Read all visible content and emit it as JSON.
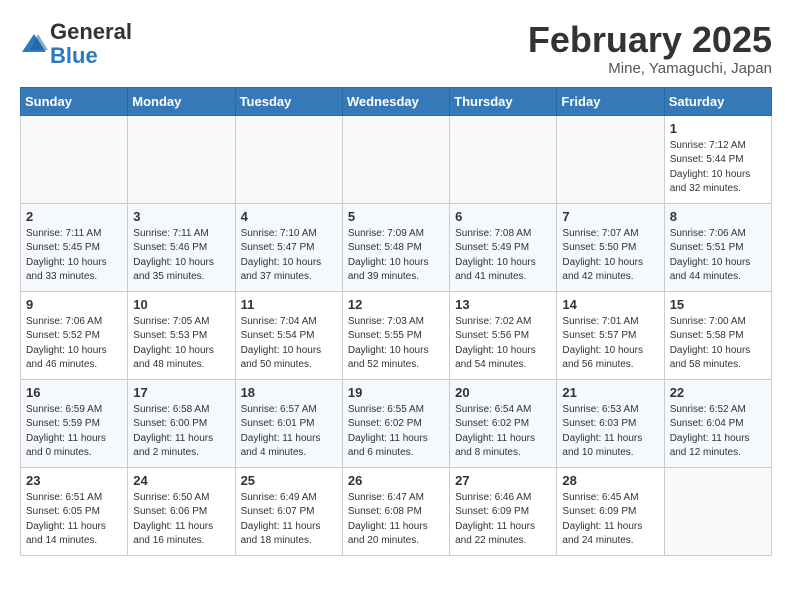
{
  "header": {
    "logo_general": "General",
    "logo_blue": "Blue",
    "month_title": "February 2025",
    "location": "Mine, Yamaguchi, Japan"
  },
  "days_of_week": [
    "Sunday",
    "Monday",
    "Tuesday",
    "Wednesday",
    "Thursday",
    "Friday",
    "Saturday"
  ],
  "weeks": [
    [
      {
        "day": null
      },
      {
        "day": null
      },
      {
        "day": null
      },
      {
        "day": null
      },
      {
        "day": null
      },
      {
        "day": null
      },
      {
        "day": 1,
        "sunrise": "7:12 AM",
        "sunset": "5:44 PM",
        "daylight": "Daylight: 10 hours and 32 minutes."
      }
    ],
    [
      {
        "day": 2,
        "sunrise": "7:11 AM",
        "sunset": "5:45 PM",
        "daylight": "Daylight: 10 hours and 33 minutes."
      },
      {
        "day": 3,
        "sunrise": "7:11 AM",
        "sunset": "5:46 PM",
        "daylight": "Daylight: 10 hours and 35 minutes."
      },
      {
        "day": 4,
        "sunrise": "7:10 AM",
        "sunset": "5:47 PM",
        "daylight": "Daylight: 10 hours and 37 minutes."
      },
      {
        "day": 5,
        "sunrise": "7:09 AM",
        "sunset": "5:48 PM",
        "daylight": "Daylight: 10 hours and 39 minutes."
      },
      {
        "day": 6,
        "sunrise": "7:08 AM",
        "sunset": "5:49 PM",
        "daylight": "Daylight: 10 hours and 41 minutes."
      },
      {
        "day": 7,
        "sunrise": "7:07 AM",
        "sunset": "5:50 PM",
        "daylight": "Daylight: 10 hours and 42 minutes."
      },
      {
        "day": 8,
        "sunrise": "7:06 AM",
        "sunset": "5:51 PM",
        "daylight": "Daylight: 10 hours and 44 minutes."
      }
    ],
    [
      {
        "day": 9,
        "sunrise": "7:06 AM",
        "sunset": "5:52 PM",
        "daylight": "Daylight: 10 hours and 46 minutes."
      },
      {
        "day": 10,
        "sunrise": "7:05 AM",
        "sunset": "5:53 PM",
        "daylight": "Daylight: 10 hours and 48 minutes."
      },
      {
        "day": 11,
        "sunrise": "7:04 AM",
        "sunset": "5:54 PM",
        "daylight": "Daylight: 10 hours and 50 minutes."
      },
      {
        "day": 12,
        "sunrise": "7:03 AM",
        "sunset": "5:55 PM",
        "daylight": "Daylight: 10 hours and 52 minutes."
      },
      {
        "day": 13,
        "sunrise": "7:02 AM",
        "sunset": "5:56 PM",
        "daylight": "Daylight: 10 hours and 54 minutes."
      },
      {
        "day": 14,
        "sunrise": "7:01 AM",
        "sunset": "5:57 PM",
        "daylight": "Daylight: 10 hours and 56 minutes."
      },
      {
        "day": 15,
        "sunrise": "7:00 AM",
        "sunset": "5:58 PM",
        "daylight": "Daylight: 10 hours and 58 minutes."
      }
    ],
    [
      {
        "day": 16,
        "sunrise": "6:59 AM",
        "sunset": "5:59 PM",
        "daylight": "Daylight: 11 hours and 0 minutes."
      },
      {
        "day": 17,
        "sunrise": "6:58 AM",
        "sunset": "6:00 PM",
        "daylight": "Daylight: 11 hours and 2 minutes."
      },
      {
        "day": 18,
        "sunrise": "6:57 AM",
        "sunset": "6:01 PM",
        "daylight": "Daylight: 11 hours and 4 minutes."
      },
      {
        "day": 19,
        "sunrise": "6:55 AM",
        "sunset": "6:02 PM",
        "daylight": "Daylight: 11 hours and 6 minutes."
      },
      {
        "day": 20,
        "sunrise": "6:54 AM",
        "sunset": "6:02 PM",
        "daylight": "Daylight: 11 hours and 8 minutes."
      },
      {
        "day": 21,
        "sunrise": "6:53 AM",
        "sunset": "6:03 PM",
        "daylight": "Daylight: 11 hours and 10 minutes."
      },
      {
        "day": 22,
        "sunrise": "6:52 AM",
        "sunset": "6:04 PM",
        "daylight": "Daylight: 11 hours and 12 minutes."
      }
    ],
    [
      {
        "day": 23,
        "sunrise": "6:51 AM",
        "sunset": "6:05 PM",
        "daylight": "Daylight: 11 hours and 14 minutes."
      },
      {
        "day": 24,
        "sunrise": "6:50 AM",
        "sunset": "6:06 PM",
        "daylight": "Daylight: 11 hours and 16 minutes."
      },
      {
        "day": 25,
        "sunrise": "6:49 AM",
        "sunset": "6:07 PM",
        "daylight": "Daylight: 11 hours and 18 minutes."
      },
      {
        "day": 26,
        "sunrise": "6:47 AM",
        "sunset": "6:08 PM",
        "daylight": "Daylight: 11 hours and 20 minutes."
      },
      {
        "day": 27,
        "sunrise": "6:46 AM",
        "sunset": "6:09 PM",
        "daylight": "Daylight: 11 hours and 22 minutes."
      },
      {
        "day": 28,
        "sunrise": "6:45 AM",
        "sunset": "6:09 PM",
        "daylight": "Daylight: 11 hours and 24 minutes."
      },
      {
        "day": null
      }
    ]
  ]
}
